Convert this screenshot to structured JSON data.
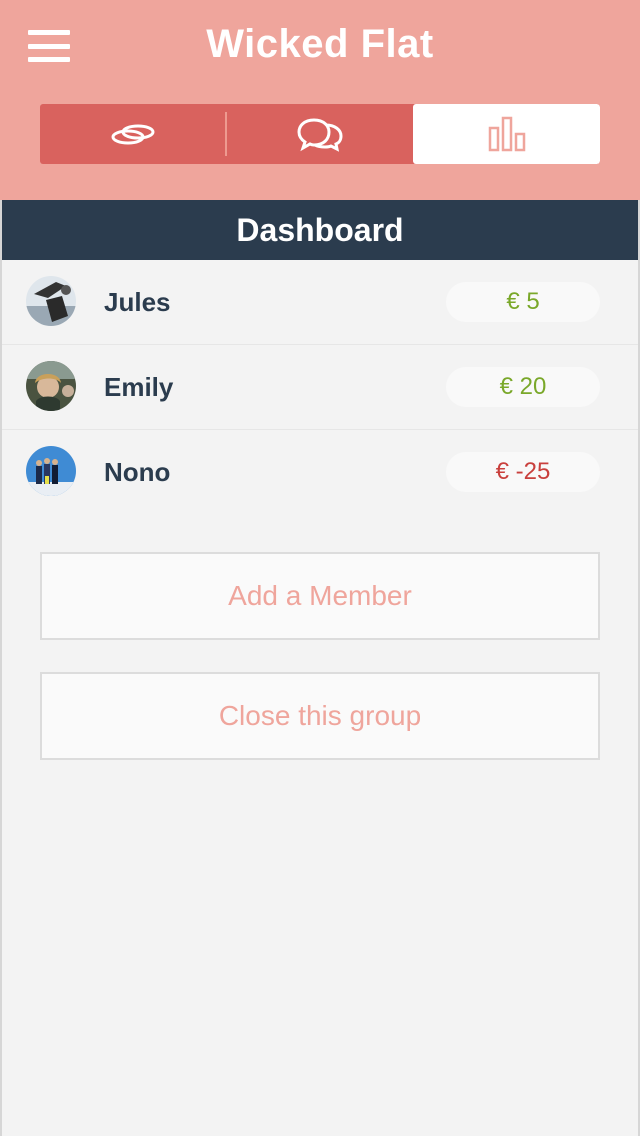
{
  "header": {
    "title": "Wicked Flat",
    "tabs": [
      {
        "icon": "rings-icon",
        "active": false
      },
      {
        "icon": "chat-bubbles-icon",
        "active": false
      },
      {
        "icon": "bar-chart-icon",
        "active": true
      }
    ]
  },
  "section_title": "Dashboard",
  "members": [
    {
      "name": "Jules",
      "amount": "€ 5",
      "status": "positive"
    },
    {
      "name": "Emily",
      "amount": "€ 20",
      "status": "positive"
    },
    {
      "name": "Nono",
      "amount": "€ -25",
      "status": "negative"
    }
  ],
  "actions": {
    "add_member": "Add a Member",
    "close_group": "Close this group"
  },
  "colors": {
    "header": "#efa59c",
    "segment": "#d9625e",
    "dashboard_bar": "#2b3c4e",
    "positive": "#7aa82a",
    "negative": "#c9403d"
  }
}
